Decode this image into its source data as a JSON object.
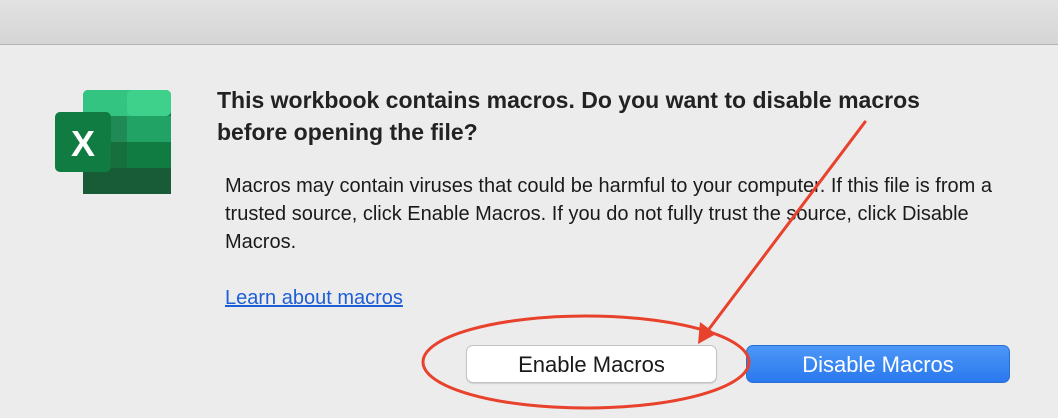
{
  "dialog": {
    "headline": "This workbook contains macros. Do you want to disable macros before opening the file?",
    "message": "Macros may contain viruses that could be harmful to your computer.  If this file is from a trusted source, click Enable Macros. If you do not fully trust the source, click Disable Macros.",
    "learn_link": "Learn about macros",
    "enable_button": "Enable Macros",
    "disable_button": "Disable Macros",
    "app_icon": "excel-icon",
    "app_icon_letter": "X"
  },
  "colors": {
    "accent_button": "#2a78ee",
    "link": "#1d5fd6",
    "annotation": "#e8412c",
    "excel_green": "#1d7a45"
  }
}
